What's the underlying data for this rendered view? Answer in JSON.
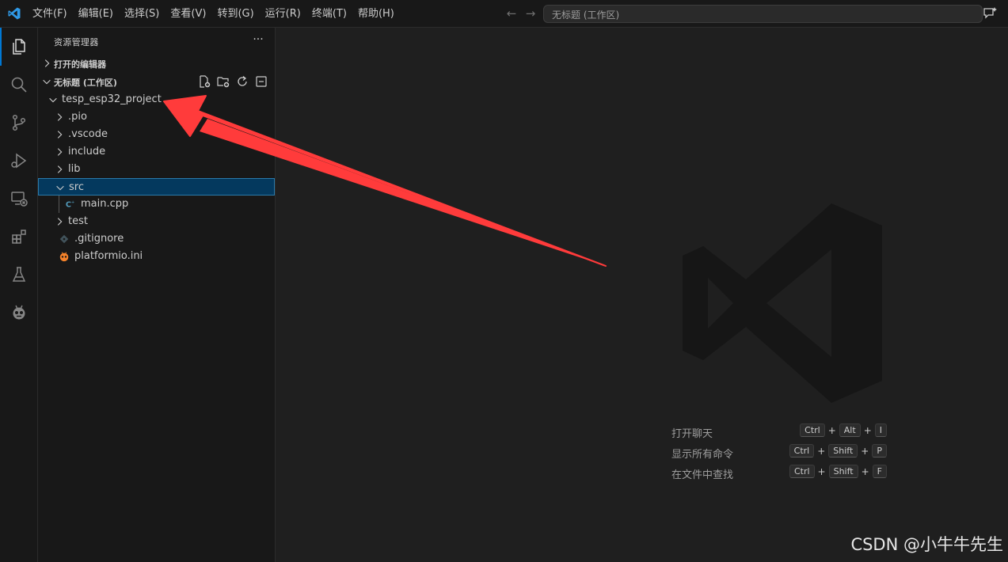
{
  "colors": {
    "accent": "#0078d4",
    "selection": "#04395e",
    "annotation_arrow": "#ff3b3b",
    "cpp_icon": "#519aba",
    "platformio_icon": "#f5822a"
  },
  "titlebar": {
    "logo_icon": "vscode-logo-icon",
    "menu": [
      "文件(F)",
      "编辑(E)",
      "选择(S)",
      "查看(V)",
      "转到(G)",
      "运行(R)",
      "终端(T)",
      "帮助(H)"
    ],
    "back_icon": "arrow-left-icon",
    "forward_icon": "arrow-right-icon",
    "command_center": "无标题 (工作区)",
    "chat_icon": "chat-sparkle-icon"
  },
  "activitybar": {
    "items": [
      {
        "icon": "files-icon",
        "active": true
      },
      {
        "icon": "search-icon"
      },
      {
        "icon": "source-control-icon"
      },
      {
        "icon": "run-debug-icon"
      },
      {
        "icon": "remote-explorer-icon"
      },
      {
        "icon": "extensions-icon"
      },
      {
        "icon": "testing-icon"
      },
      {
        "icon": "platformio-icon"
      }
    ]
  },
  "sidebar": {
    "title": "资源管理器",
    "more": "···",
    "open_editors": "打开的编辑器",
    "workspace": "无标题 (工作区)",
    "workspace_actions": [
      "new-file-icon",
      "new-folder-icon",
      "refresh-icon",
      "collapse-all-icon"
    ],
    "tree": [
      {
        "name": "tesp_esp32_project",
        "type": "folder",
        "expanded": true
      },
      {
        "name": ".pio",
        "type": "folder"
      },
      {
        "name": ".vscode",
        "type": "folder"
      },
      {
        "name": "include",
        "type": "folder"
      },
      {
        "name": "lib",
        "type": "folder"
      },
      {
        "name": "src",
        "type": "folder",
        "expanded": true,
        "selected": true
      },
      {
        "name": "main.cpp",
        "type": "file",
        "icon": "cpp-file-icon"
      },
      {
        "name": "test",
        "type": "folder"
      },
      {
        "name": ".gitignore",
        "type": "file",
        "icon": "git-file-icon"
      },
      {
        "name": "platformio.ini",
        "type": "file",
        "icon": "platformio-file-icon"
      }
    ]
  },
  "editor": {
    "watermark_icon": "vscode-watermark-icon",
    "shortcuts": [
      {
        "label": "打开聊天",
        "keys": [
          "Ctrl",
          "Alt",
          "I"
        ]
      },
      {
        "label": "显示所有命令",
        "keys": [
          "Ctrl",
          "Shift",
          "P"
        ]
      },
      {
        "label": "在文件中查找",
        "keys": [
          "Ctrl",
          "Shift",
          "F"
        ]
      }
    ]
  },
  "annotation": {
    "credit": "CSDN @小牛牛先生"
  }
}
